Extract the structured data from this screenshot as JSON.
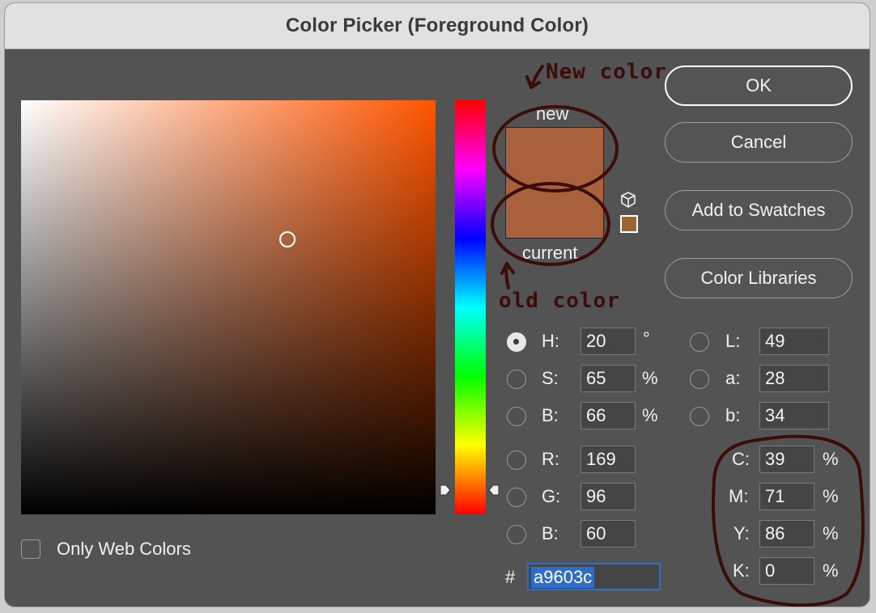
{
  "window": {
    "title": "Color Picker (Foreground Color)"
  },
  "swatches": {
    "new_label": "new",
    "current_label": "current",
    "new_color": "#a9603c",
    "current_color": "#a9603c",
    "websafe_color": "#996633"
  },
  "buttons": {
    "ok": "OK",
    "cancel": "Cancel",
    "add_to_swatches": "Add to Swatches",
    "color_libraries": "Color Libraries"
  },
  "hsb": {
    "h": {
      "label": "H:",
      "value": "20",
      "unit": "°",
      "selected": true
    },
    "s": {
      "label": "S:",
      "value": "65",
      "unit": "%"
    },
    "b": {
      "label": "B:",
      "value": "66",
      "unit": "%"
    }
  },
  "rgb": {
    "r": {
      "label": "R:",
      "value": "169"
    },
    "g": {
      "label": "G:",
      "value": "96"
    },
    "b": {
      "label": "B:",
      "value": "60"
    }
  },
  "lab": {
    "l": {
      "label": "L:",
      "value": "49"
    },
    "a": {
      "label": "a:",
      "value": "28"
    },
    "b": {
      "label": "b:",
      "value": "34"
    }
  },
  "cmyk": {
    "c": {
      "label": "C:",
      "value": "39",
      "unit": "%"
    },
    "m": {
      "label": "M:",
      "value": "71",
      "unit": "%"
    },
    "y": {
      "label": "Y:",
      "value": "86",
      "unit": "%"
    },
    "k": {
      "label": "K:",
      "value": "0",
      "unit": "%"
    }
  },
  "hex": {
    "label": "#",
    "value": "a9603c"
  },
  "only_web_colors": {
    "label": "Only Web Colors",
    "checked": false
  },
  "annotations": {
    "new_color": "New color",
    "old_color": "old color",
    "ink_color": "#3a0d08"
  }
}
